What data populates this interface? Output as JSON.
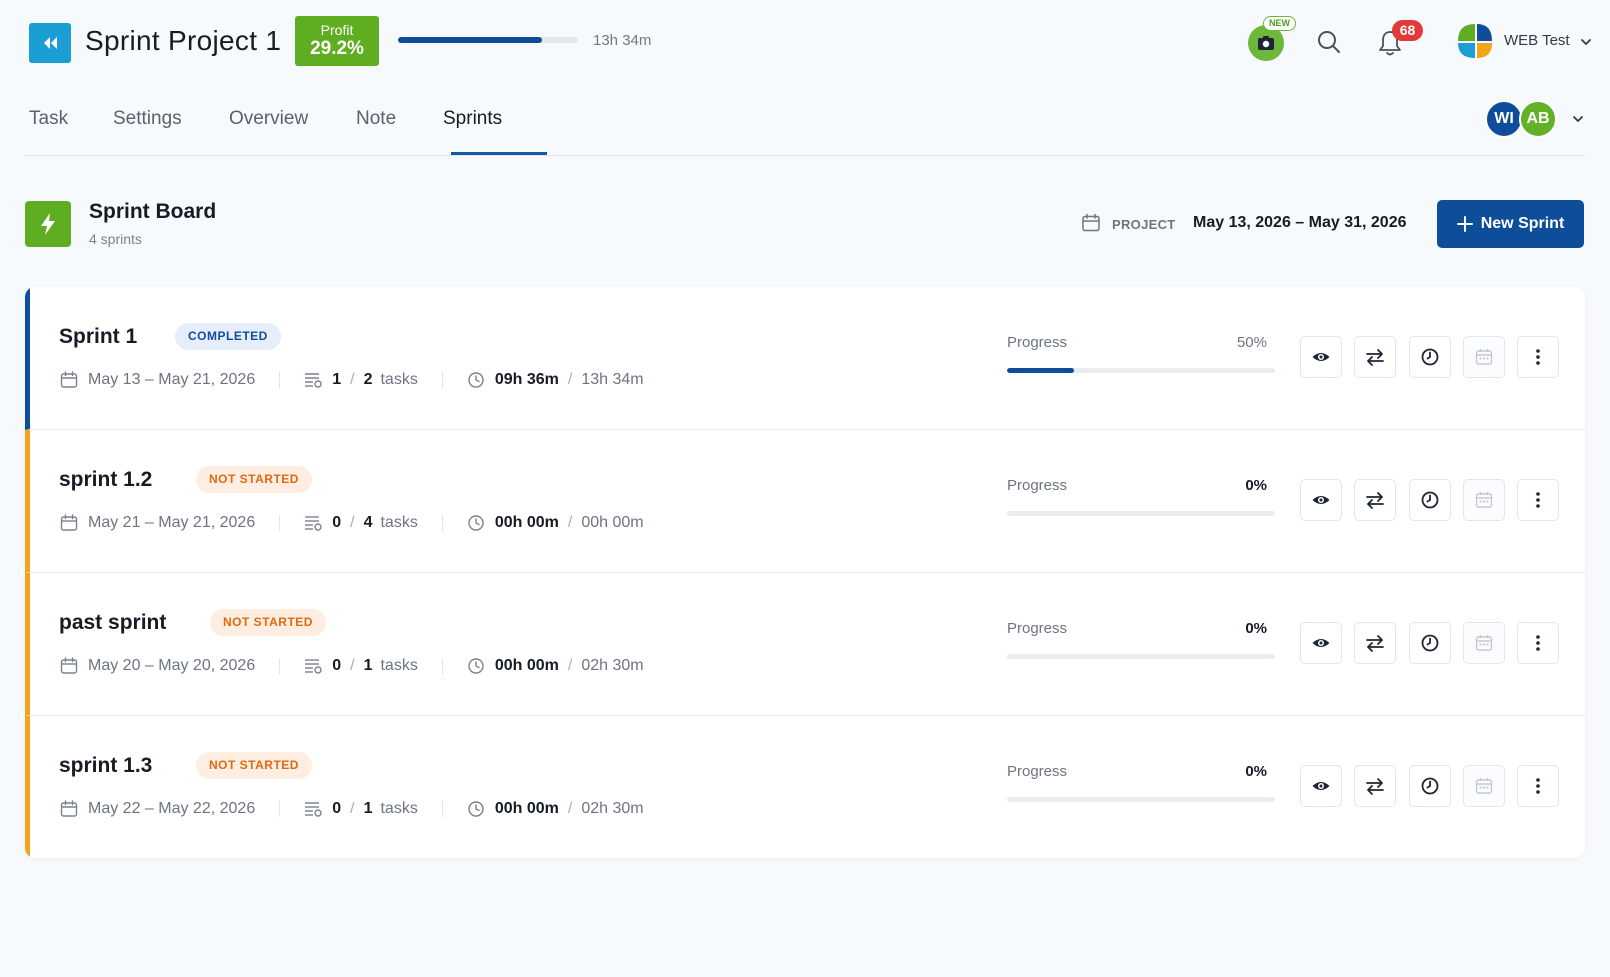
{
  "header": {
    "project_title": "Sprint Project 1",
    "profit_label": "Profit",
    "profit_value": "29.2%",
    "time_progress": 0.8,
    "time_logged": "13h 34m",
    "new_label": "NEW",
    "notification_count": "68",
    "org_name": "WEB Test",
    "colors": {
      "accent": "#0e4d9a",
      "brand_green": "#5fad20",
      "info": "#1a9ed4",
      "alert": "#e23a3a"
    }
  },
  "tabs": [
    {
      "label": "Task"
    },
    {
      "label": "Settings"
    },
    {
      "label": "Overview"
    },
    {
      "label": "Note"
    },
    {
      "label": "Sprints",
      "active": true
    }
  ],
  "members": [
    {
      "initials": "WI",
      "color": "#0e4d9a"
    },
    {
      "initials": "AB",
      "color": "#64b029"
    }
  ],
  "board": {
    "title": "Sprint Board",
    "subtitle": "4 sprints",
    "project_label": "PROJECT",
    "project_range": "May 13, 2026 – May 31, 2026",
    "new_sprint_label": "New Sprint"
  },
  "sprints": [
    {
      "name": "Sprint 1",
      "status": "COMPLETED",
      "dates": "May 13 – May 21, 2026",
      "tasks_done": "1",
      "tasks_total": "2",
      "tasks_label": "tasks",
      "time_spent": "09h 36m",
      "time_estimate": "13h 34m",
      "progress_label": "Progress",
      "progress_text": "50%",
      "progress": 0.5
    },
    {
      "name": "sprint 1.2",
      "status": "NOT STARTED",
      "dates": "May 21 – May 21, 2026",
      "tasks_done": "0",
      "tasks_total": "4",
      "tasks_label": "tasks",
      "time_spent": "00h 00m",
      "time_estimate": "00h 00m",
      "progress_label": "Progress",
      "progress_text": "0%",
      "progress": 0
    },
    {
      "name": "past sprint",
      "status": "NOT STARTED",
      "dates": "May 20 – May 20, 2026",
      "tasks_done": "0",
      "tasks_total": "1",
      "tasks_label": "tasks",
      "time_spent": "00h 00m",
      "time_estimate": "02h 30m",
      "progress_label": "Progress",
      "progress_text": "0%",
      "progress": 0
    },
    {
      "name": "sprint 1.3",
      "status": "NOT STARTED",
      "dates": "May 22 – May 22, 2026",
      "tasks_done": "0",
      "tasks_total": "1",
      "tasks_label": "tasks",
      "time_spent": "00h 00m",
      "time_estimate": "02h 30m",
      "progress_label": "Progress",
      "progress_text": "0%",
      "progress": 0
    }
  ],
  "actions": [
    {
      "icon": "eye-icon"
    },
    {
      "icon": "swap-icon"
    },
    {
      "icon": "clock-icon"
    },
    {
      "icon": "calendar-icon"
    },
    {
      "icon": "more-vertical-icon"
    }
  ]
}
